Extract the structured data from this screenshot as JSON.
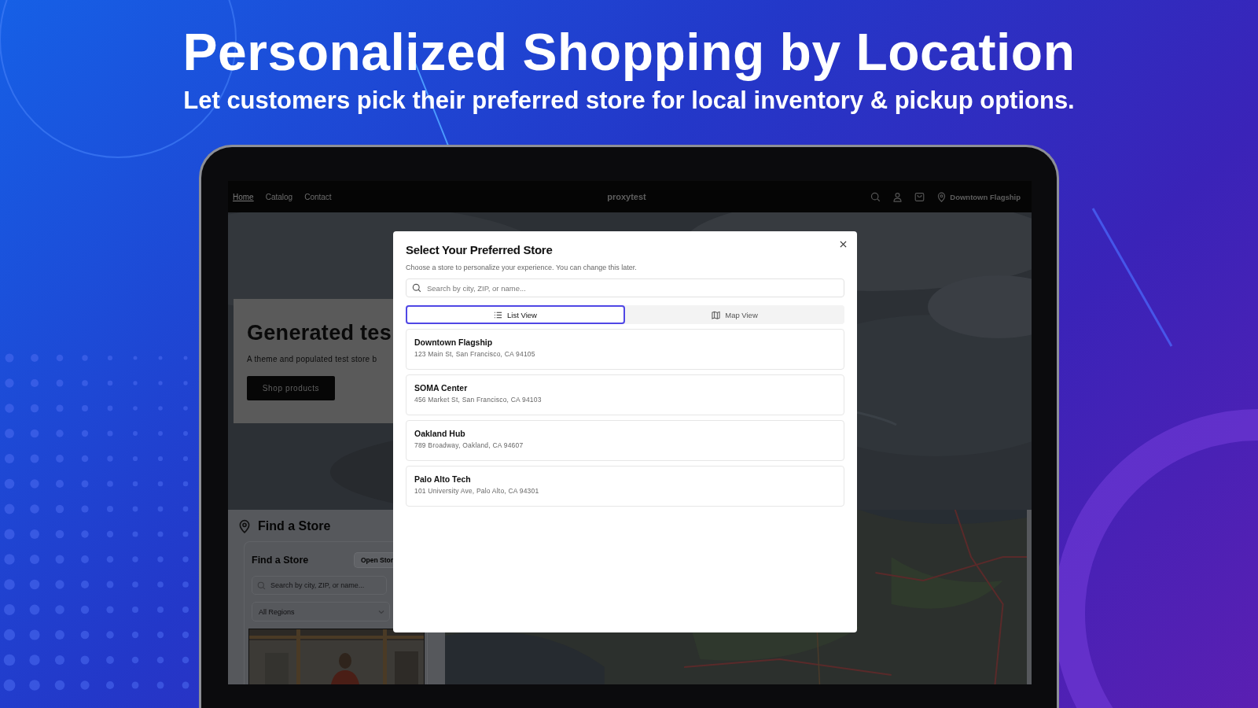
{
  "headline": {
    "title": "Personalized Shopping by Location",
    "subtitle": "Let customers pick their preferred store for local inventory & pickup options."
  },
  "store_site": {
    "nav": {
      "links": [
        {
          "label": "Home",
          "selected": true
        },
        {
          "label": "Catalog",
          "selected": false
        },
        {
          "label": "Contact",
          "selected": false
        }
      ],
      "brand": "proxytest",
      "location": "Downtown Flagship"
    },
    "hero": {
      "title": "Generated tes",
      "text": "A theme and populated test store b",
      "button": "Shop products"
    },
    "find_store": {
      "title": "Find a Store",
      "panel_title": "Find a Store",
      "open_button": "Open Stor",
      "search_placeholder": "Search by city, ZIP, or name...",
      "region": "All Regions"
    }
  },
  "modal": {
    "title": "Select Your Preferred Store",
    "subtitle": "Choose a store to personalize your experience. You can change this later.",
    "search_placeholder": "Search by city, ZIP, or name...",
    "tabs": [
      {
        "label": "List View",
        "kind": "list",
        "selected": true
      },
      {
        "label": "Map View",
        "kind": "map",
        "selected": false
      }
    ],
    "stores": [
      {
        "name": "Downtown Flagship",
        "address": "123 Main St, San Francisco, CA 94105"
      },
      {
        "name": "SOMA Center",
        "address": "456 Market St, San Francisco, CA 94103"
      },
      {
        "name": "Oakland Hub",
        "address": "789 Broadway, Oakland, CA 94607"
      },
      {
        "name": "Palo Alto Tech",
        "address": "101 University Ave, Palo Alto, CA 94301"
      }
    ]
  }
}
